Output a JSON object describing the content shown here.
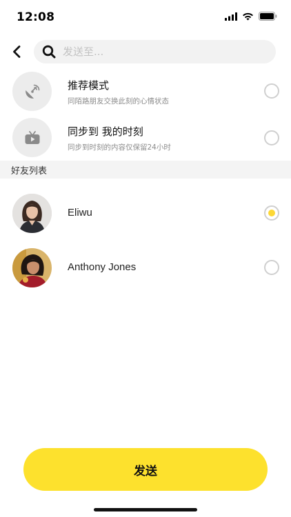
{
  "status_bar": {
    "time": "12:08"
  },
  "search": {
    "placeholder": "发送至..."
  },
  "options": [
    {
      "title": "推荐模式",
      "subtitle": "同陌路朋友交换此刻的心情状态",
      "icon": "satellite-dish-icon",
      "selected": false
    },
    {
      "title": "同步到 我的时刻",
      "subtitle": "同步到时刻的内容仅保留24小时",
      "icon": "tv-play-icon",
      "selected": false
    }
  ],
  "friends_section": {
    "title": "好友列表"
  },
  "friends": [
    {
      "name": "Eliwu",
      "selected": true
    },
    {
      "name": "Anthony Jones",
      "selected": false
    }
  ],
  "send_button": {
    "label": "发送"
  },
  "colors": {
    "accent": "#fde12d",
    "radio_border": "#cfcfcf",
    "section_bg": "#f4f4f4",
    "icon_bg": "#ececec"
  }
}
